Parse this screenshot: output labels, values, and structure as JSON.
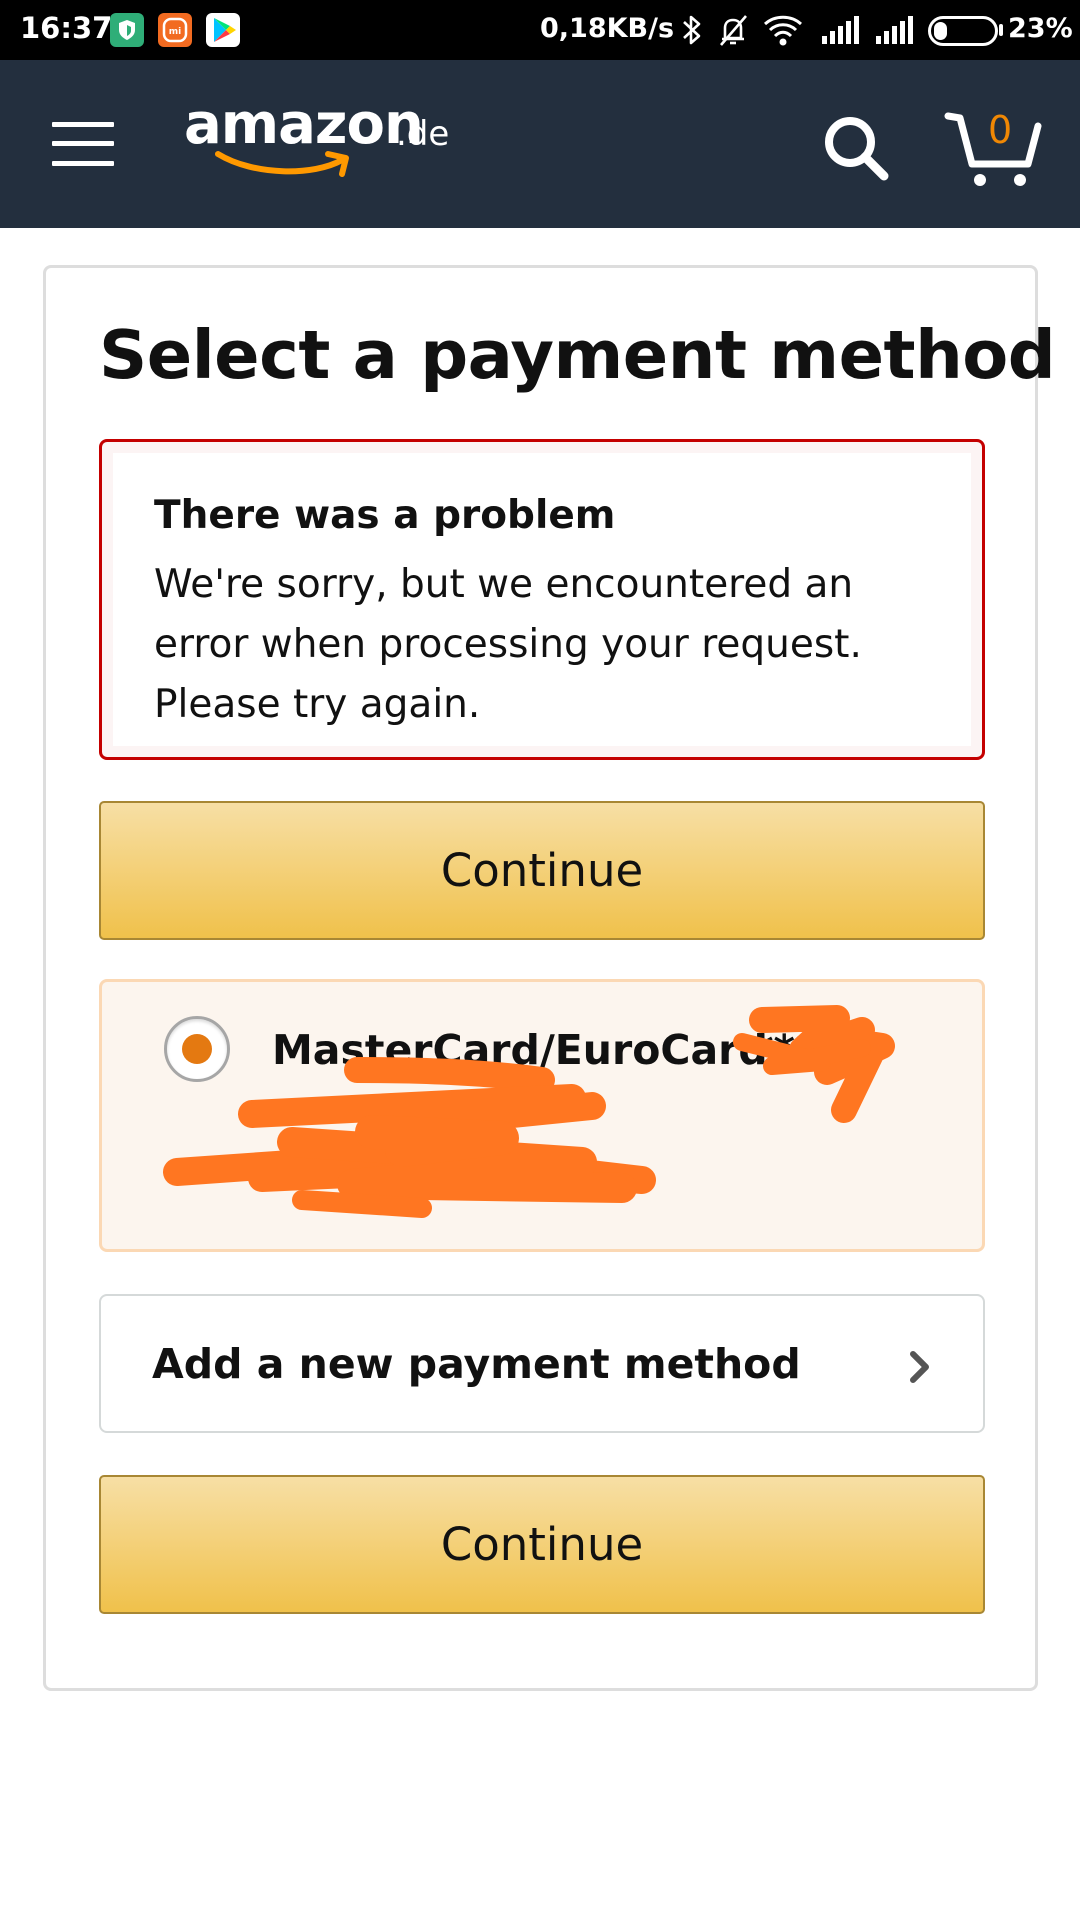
{
  "status_bar": {
    "time": "16:37",
    "network_speed": "0,18KB/s",
    "battery_percent": "23%",
    "battery_level": 0.23,
    "icons": [
      "shield-app-icon",
      "mi-app-icon",
      "play-store-icon",
      "bluetooth-icon",
      "bell-off-icon",
      "wifi-icon",
      "signal-icon",
      "signal-icon",
      "battery-icon"
    ]
  },
  "header": {
    "logo_main": "amazon",
    "logo_tld": ".de",
    "cart_count": "0",
    "icons": [
      "menu-icon",
      "search-icon",
      "cart-icon"
    ]
  },
  "page": {
    "title": "Select a payment method"
  },
  "alert": {
    "heading": "There was a problem",
    "body": "We're sorry, but we encountered an error when processing your request. Please try again."
  },
  "buttons": {
    "continue_top": "Continue",
    "continue_bottom": "Continue"
  },
  "payment_option": {
    "card_name": "MasterCard/EuroCard",
    "card_number": "****",
    "card_holder": "",
    "card_expiry": "",
    "selected": true
  },
  "add_method": {
    "label": "Add a new payment method"
  },
  "colors": {
    "header_bg": "#232f3e",
    "logo_smile": "#ff9900",
    "cart_count": "#f08804",
    "alert_border": "#c40000",
    "button_gradient_top": "#f7dfa5",
    "button_gradient_bottom": "#f0c14b",
    "button_border": "#a88734",
    "selected_option_bg": "#fcf5ee",
    "selected_option_border": "#fbd8b4",
    "radio_dot": "#e47911",
    "redaction": "#ff7621"
  }
}
